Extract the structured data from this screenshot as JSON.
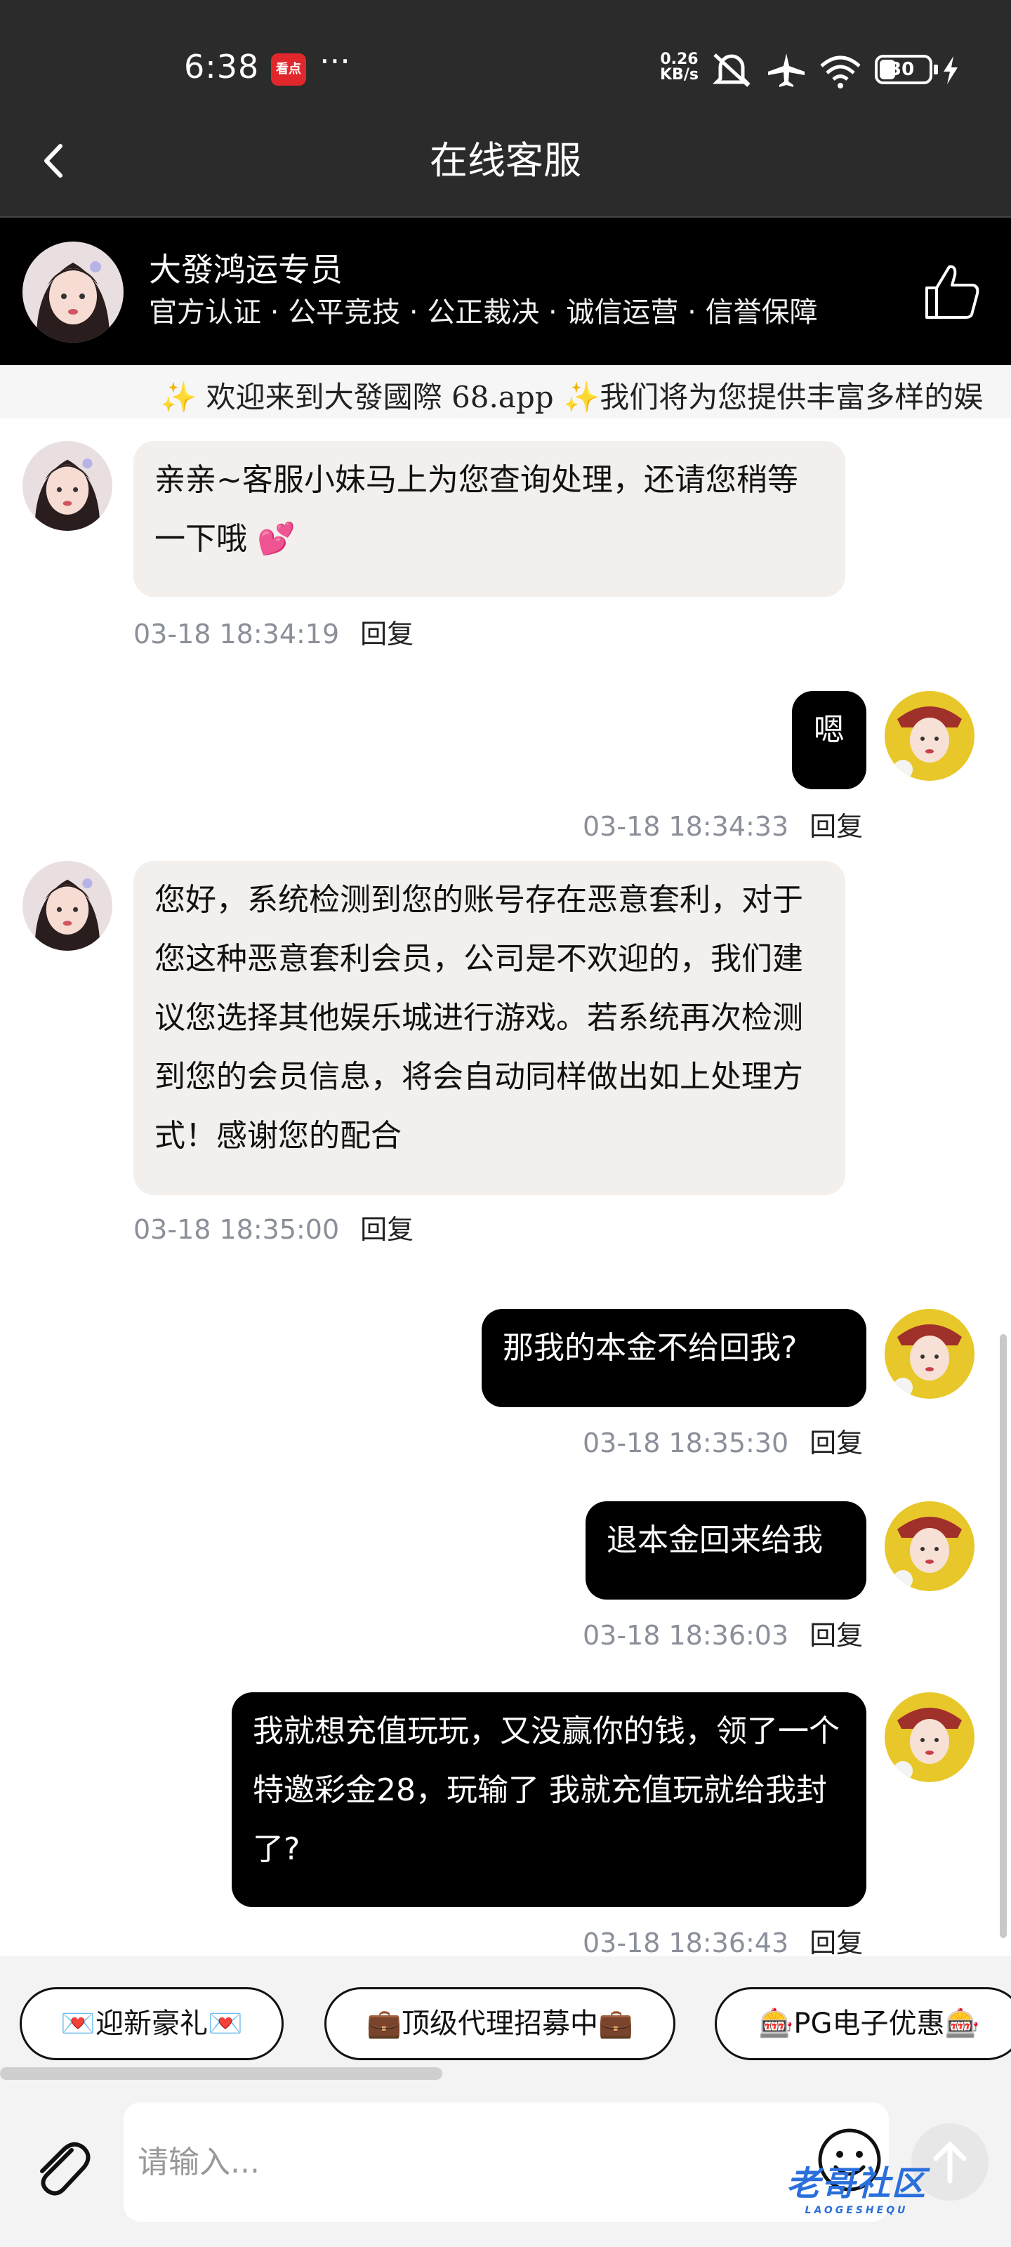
{
  "status": {
    "time": "6:38",
    "app_badge": "看点",
    "more": "···",
    "net_speed_value": "0.26",
    "net_speed_unit": "KB/s",
    "battery": "30"
  },
  "nav": {
    "title": "在线客服"
  },
  "agent": {
    "name": "大發鸿运专员",
    "tags": "官方认证 · 公平竞技 · 公正裁决 · 诚信运营 · 信誉保障"
  },
  "marquee": "✨ 欢迎来到大發國際 68.app ✨我们将为您提供丰富多样的娱",
  "reply_label": "回复",
  "messages": [
    {
      "side": "in",
      "text": "亲亲~客服小妹马上为您查询处理，还请您稍等一下哦 💕",
      "time": "03-18 18:34:19"
    },
    {
      "side": "out",
      "text": "嗯",
      "time": "03-18 18:34:33"
    },
    {
      "side": "in",
      "text": "您好，系统检测到您的账号存在恶意套利，对于您这种恶意套利会员，公司是不欢迎的，我们建议您选择其他娱乐城进行游戏。若系统再次检测到您的会员信息，将会自动同样做出如上处理方式！感谢您的配合",
      "time": "03-18 18:35:00"
    },
    {
      "side": "out",
      "text": "那我的本金不给回我?",
      "time": "03-18 18:35:30"
    },
    {
      "side": "out",
      "text": "退本金回来给我",
      "time": "03-18 18:36:03"
    },
    {
      "side": "out",
      "text": "我就想充值玩玩，又没赢你的钱，领了一个特邀彩金28，玩输了 我就充值玩就给我封了?",
      "time": "03-18 18:36:43"
    }
  ],
  "quick_buttons": [
    "💌迎新豪礼💌",
    "💼顶级代理招募中💼",
    "🎰PG电子优惠🎰"
  ],
  "input": {
    "placeholder": "请输入..."
  },
  "watermark": {
    "text": "老哥社区",
    "sub": "LAOGESHEQU"
  },
  "colors": {
    "bar_dark": "#2b2b2b",
    "agent_bar": "#000000",
    "bubble_in": "#f2efec",
    "bubble_out": "#000000",
    "timestamp": "#8a8f99"
  }
}
